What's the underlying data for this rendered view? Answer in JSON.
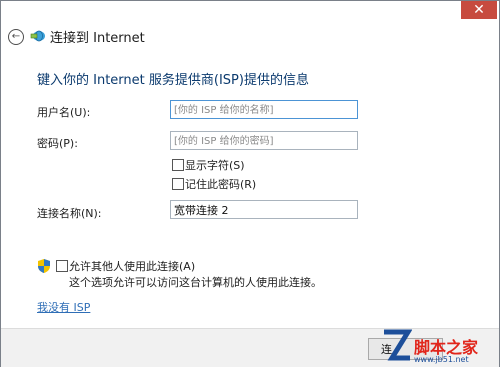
{
  "window": {
    "title": "连接到 Internet",
    "close_glyph": "✕",
    "back_glyph": "←"
  },
  "heading": "键入你的 Internet 服务提供商(ISP)提供的信息",
  "form": {
    "username_label": "用户名(U):",
    "username_placeholder": "[你的 ISP 给你的名称]",
    "password_label": "密码(P):",
    "password_placeholder": "[你的 ISP 给你的密码]",
    "show_chars_label": "显示字符(S)",
    "remember_label": "记住此密码(R)",
    "conn_name_label": "连接名称(N):",
    "conn_name_value": "宽带连接 2"
  },
  "allow_others": {
    "label": "允许其他人使用此连接(A)",
    "description": "这个选项允许可以访问这台计算机的人使用此连接。"
  },
  "no_isp_link": "我没有 ISP",
  "footer": {
    "connect_label": "连"
  },
  "watermark": {
    "brand": "脚本之家",
    "url": "www.jb51.net"
  },
  "colors": {
    "accent": "#0b3a6e",
    "link": "#2f6eb6",
    "close": "#c74b3f"
  }
}
